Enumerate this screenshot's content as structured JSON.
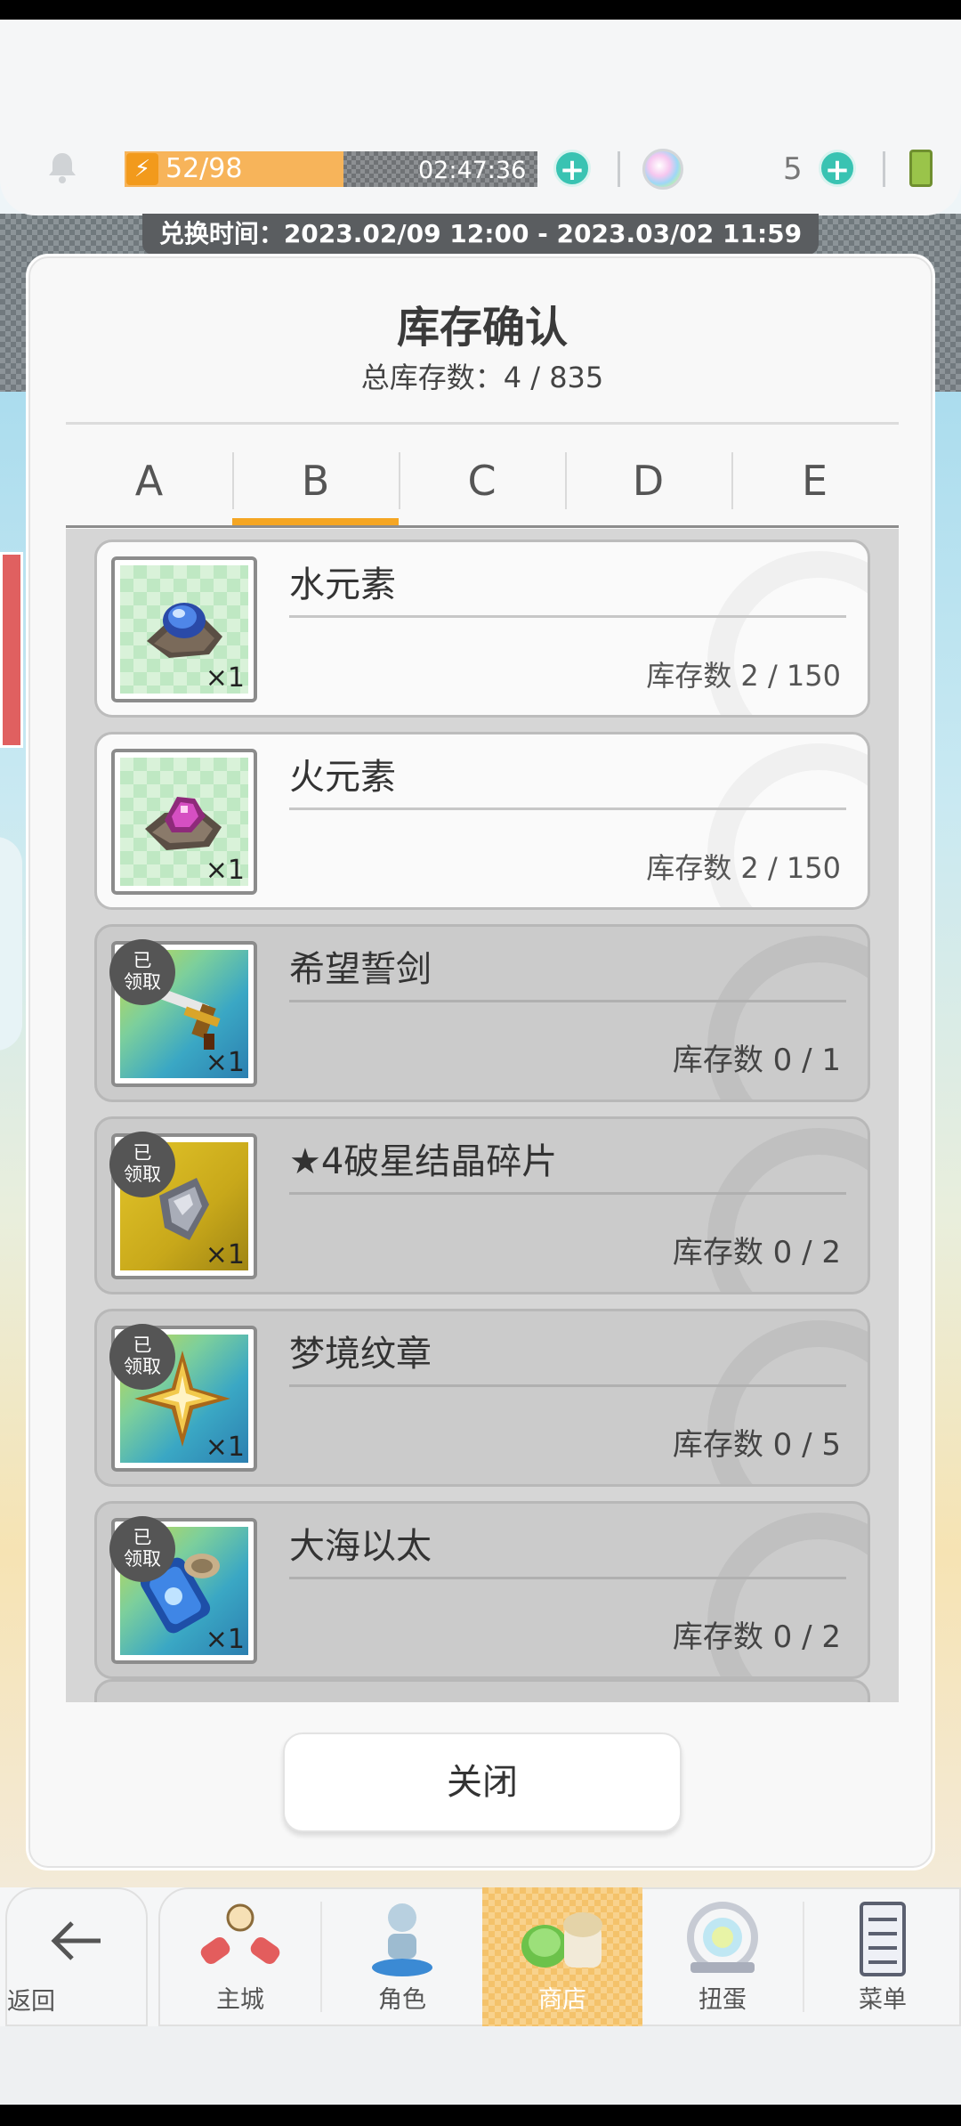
{
  "status_bar": {
    "stamina_text": "52/98",
    "stamina_fraction": 0.53,
    "timer": "02:47:36",
    "gem_count": "5"
  },
  "exchange_banner": "兑换时间：2023.02/09 12:00 - 2023.03/02 11:59",
  "modal": {
    "title": "库存确认",
    "subtitle": "总库存数：4 / 835",
    "tabs": [
      {
        "label": "A"
      },
      {
        "label": "B"
      },
      {
        "label": "C"
      },
      {
        "label": "D"
      },
      {
        "label": "E"
      }
    ],
    "selected_tab": "B",
    "claimed_badge": "已\n领取",
    "items": [
      {
        "name": "水元素",
        "qty": "×1",
        "stock": "库存数 2 / 150",
        "claimed": false
      },
      {
        "name": "火元素",
        "qty": "×1",
        "stock": "库存数 2 / 150",
        "claimed": false
      },
      {
        "name": "希望誓剑",
        "qty": "×1",
        "stock": "库存数 0 / 1",
        "claimed": true
      },
      {
        "name": "★4破星结晶碎片",
        "qty": "×1",
        "stock": "库存数 0 / 2",
        "claimed": true
      },
      {
        "name": "梦境纹章",
        "qty": "×1",
        "stock": "库存数 0 / 5",
        "claimed": true
      },
      {
        "name": "大海以太",
        "qty": "×1",
        "stock": "库存数 0 / 2",
        "claimed": true
      }
    ],
    "close_label": "关闭"
  },
  "bottom_nav": {
    "back_label": "返回",
    "items": [
      {
        "label": "主城",
        "icon": "castle-icon"
      },
      {
        "label": "角色",
        "icon": "character-icon"
      },
      {
        "label": "商店",
        "icon": "shop-icon"
      },
      {
        "label": "扭蛋",
        "icon": "gacha-icon"
      },
      {
        "label": "菜单",
        "icon": "menu-icon"
      }
    ],
    "active": "商店"
  },
  "colors": {
    "accent_orange": "#f5a623",
    "plus_teal": "#39c3b2",
    "stamina_fill": "#f7b45a"
  }
}
